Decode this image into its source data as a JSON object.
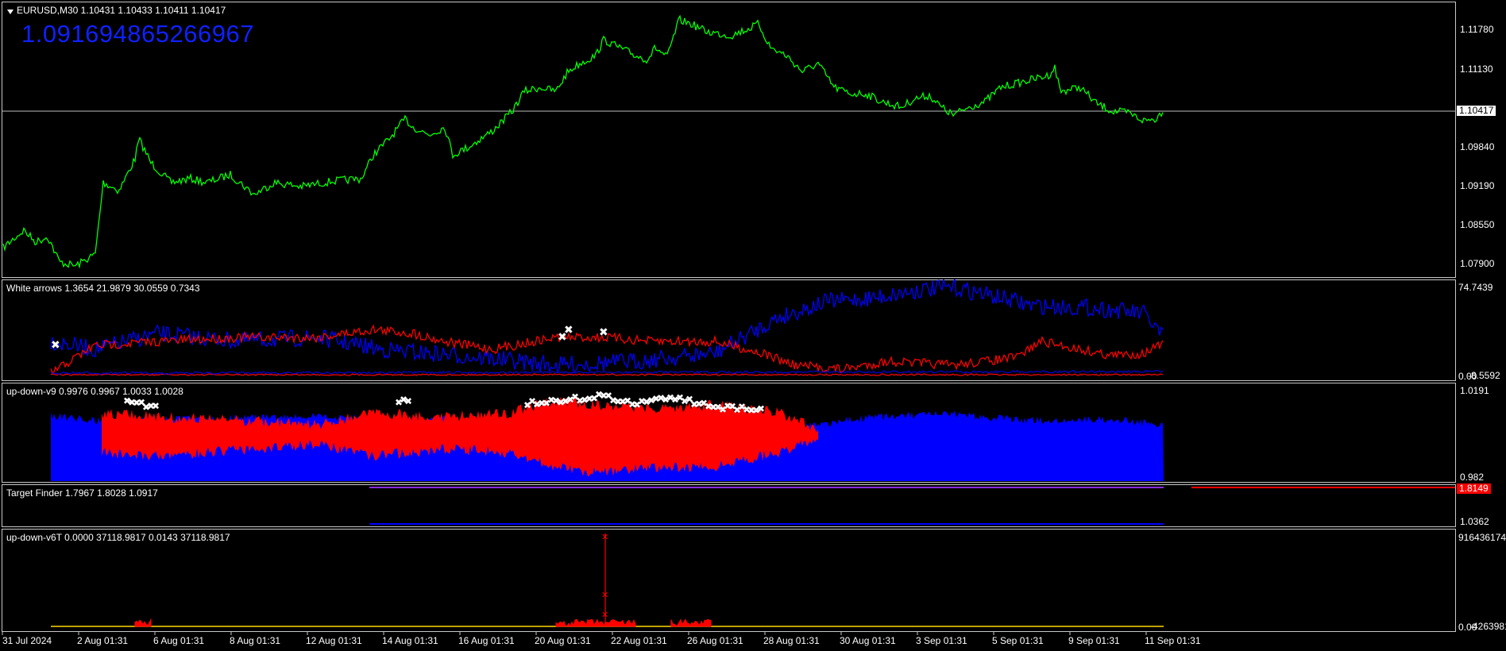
{
  "main": {
    "symbol_label": "EURUSD,M30  1.10431 1.10433 1.10411 1.10417",
    "big_value": "1.091694865266967",
    "price_axis": [
      "1.11780",
      "1.11130",
      "1.10417",
      "1.09840",
      "1.09190",
      "1.08550",
      "1.07900"
    ],
    "current_price": "1.10417"
  },
  "white_arrows": {
    "label": "White arrows 1.3654 21.9879 30.0559 0.7343",
    "axis_top": "74.7439",
    "axis_bottom": "-8.5592",
    "axis_zero": "0.00"
  },
  "updown_v9": {
    "label": "up-down-v9 0.9976 0.9967 1.0033 1.0028",
    "axis_top": "1.0191",
    "axis_bottom": "0.982"
  },
  "target_finder": {
    "label": "Target Finder 1.7967 1.8028 1.0917",
    "axis_top_value": "1.8149",
    "axis_bottom": "1.0362"
  },
  "updown_v6t": {
    "label": "up-down-v6T 0.0000 37118.9817 0.0143 37118.9817",
    "axis_top": "916436174",
    "axis_bottom": "-4263981",
    "axis_zero": "0.00"
  },
  "time_axis": [
    "31 Jul 2024",
    "2 Aug 01:31",
    "6 Aug 01:31",
    "8 Aug 01:31",
    "12 Aug 01:31",
    "14 Aug 01:31",
    "16 Aug 01:31",
    "20 Aug 01:31",
    "22 Aug 01:31",
    "26 Aug 01:31",
    "28 Aug 01:31",
    "30 Aug 01:31",
    "3 Sep 01:31",
    "5 Sep 01:31",
    "9 Sep 01:31",
    "11 Sep 01:31"
  ],
  "colors": {
    "price_line": "#00ff00",
    "blue": "#0000ff",
    "red": "#ff0000",
    "white": "#ffffff",
    "yellow": "#ffd700"
  }
}
